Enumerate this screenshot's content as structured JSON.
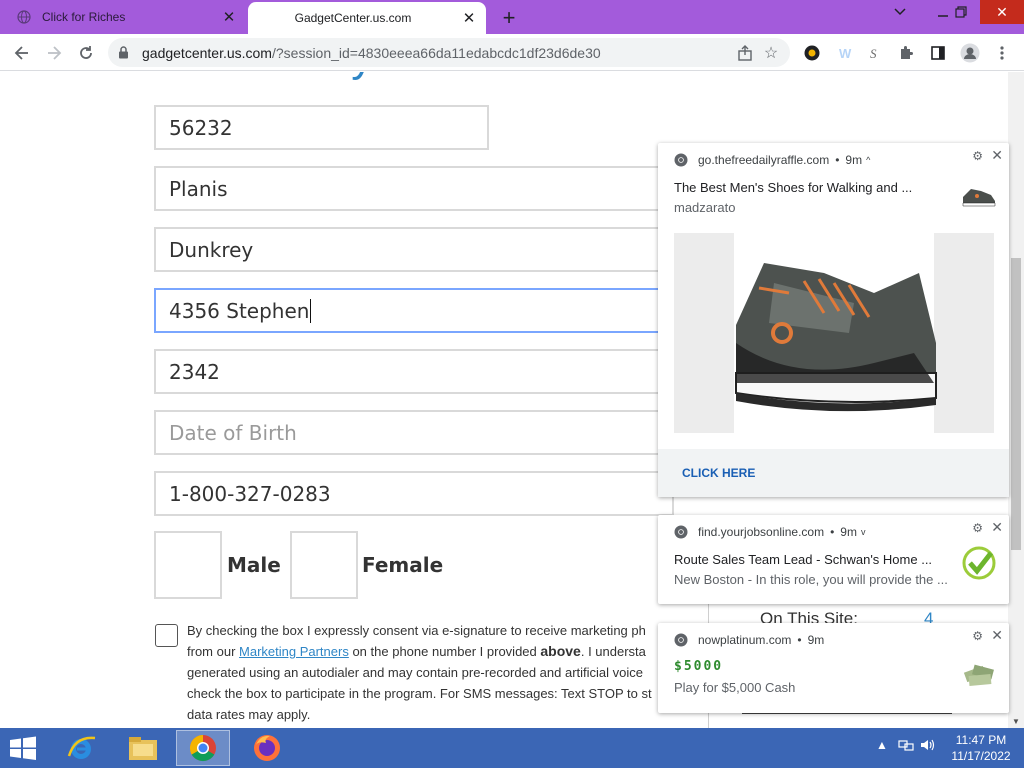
{
  "browser": {
    "tabs": [
      {
        "title": "Click for Riches",
        "active": false
      },
      {
        "title": "GadgetCenter.us.com",
        "active": true
      }
    ],
    "url_host": "gadgetcenter.us.com",
    "url_path": "/?session_id=4830eeea66da11edabcdc1df23d6de30"
  },
  "page": {
    "heading": "Please enter your information below",
    "fields": [
      {
        "value": "56232"
      },
      {
        "value": "Planis"
      },
      {
        "value": "Dunkrey"
      },
      {
        "value": "4356 Stephen",
        "focused": true
      },
      {
        "value": "2342"
      },
      {
        "value": "",
        "placeholder": "Date of Birth"
      },
      {
        "value": "1-800-327-0283"
      }
    ],
    "gender": {
      "male_label": "Male",
      "female_label": "Female"
    },
    "consent": {
      "line1": "By checking the box I expressly consent via e-signature to receive marketing ph",
      "line2_pre": "from our ",
      "line2_link": "Marketing Partners",
      "line2_mid": " on the phone number I provided ",
      "line2_bold": "above",
      "line2_post": ". I understa",
      "line3": "generated using an autodialer and may contain pre-recorded and artificial voice",
      "line4": "check the box to participate in the program. For SMS messages: Text STOP to st",
      "line5": "data rates may apply."
    },
    "side": {
      "label": "On This Site:",
      "count": "4"
    }
  },
  "notifications": [
    {
      "source": "go.thefreedailyraffle.com",
      "age": "9m",
      "title": "The Best Men's Shoes for Walking and ...",
      "body": "madzarato",
      "action": "CLICK HERE"
    },
    {
      "source": "find.yourjobsonline.com",
      "age": "9m",
      "title": "Route Sales Team Lead - Schwan's Home ...",
      "body": "New Boston - In this role, you will provide the ..."
    },
    {
      "source": "nowplatinum.com",
      "age": "9m",
      "title": "$5000",
      "body": "Play for $5,000 Cash"
    }
  ],
  "taskbar": {
    "time": "11:47 PM",
    "date": "11/17/2022"
  },
  "colors": {
    "tab_strip": "#a35bdb",
    "taskbar": "#3b66b5",
    "link": "#2f86c6"
  }
}
